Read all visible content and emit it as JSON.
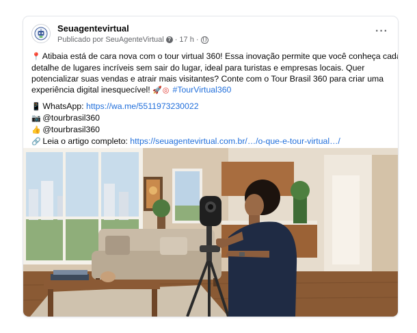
{
  "post": {
    "author": "Seuagentevirtual",
    "published_by": "Publicado por SeuAgenteVirtual",
    "time": "17 h",
    "more_label": "···",
    "body": {
      "p1_lines": [
        "Atibaia está de cara nova com o tour virtual 360! Essa inovação permite que você conheça cada",
        "detalhe de lugares incríveis sem sair do lugar, ideal para turistas e empresas locais. Quer",
        "potencializar suas vendas e atrair mais visitantes? Conte com o Tour Brasil 360 para criar uma"
      ],
      "p1_last": "experiência digital inesquecível!",
      "hashtag": "#TourVirtual360",
      "whatsapp_label": "WhatsApp:",
      "whatsapp_link": "https://wa.me/5511973230022",
      "handle1": "@tourbrasil360",
      "handle2": "@tourbrasil360",
      "article_label": "Leia o artigo completo:",
      "article_link": "https://seuagentevirtual.com.br/…/o-que-e-tour-virtual…/"
    },
    "icons": [
      "pin-icon",
      "rocket-icon",
      "target-icon",
      "phone-icon",
      "camera-icon",
      "thumbs-up-icon",
      "link-icon",
      "question-icon",
      "globe-icon"
    ]
  }
}
